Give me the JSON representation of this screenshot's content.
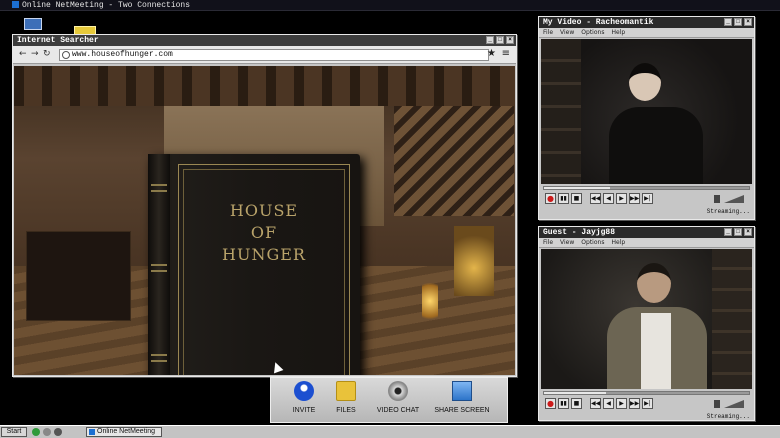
{
  "os": {
    "title": "Online NetMeeting - Two Connections",
    "desktop_icons": [
      "computer-icon",
      "mail-icon"
    ]
  },
  "browser": {
    "title": "Internet Searcher",
    "url": "www.houseofhunger.com",
    "nav": {
      "back": "←",
      "forward": "→",
      "reload": "↻",
      "bookmark": "★",
      "menu": "≡"
    },
    "page": {
      "book_title_lines": [
        "HOUSE",
        "OF",
        "HUNGER"
      ]
    }
  },
  "my_video": {
    "title": "My Video - Racheomantik",
    "menu": [
      "File",
      "View",
      "Options",
      "Help"
    ],
    "progress": 0.32,
    "status": "Streaming..."
  },
  "guest_video": {
    "title": "Guest - Jayjg88",
    "menu": [
      "File",
      "View",
      "Options",
      "Help"
    ],
    "progress": 0.3,
    "status": "Streaming..."
  },
  "player_controls": [
    "●",
    "▮▮",
    "■",
    "◀◀",
    "◀",
    "▶",
    "▶▶",
    "▶|"
  ],
  "dock": {
    "items": [
      {
        "label": "INVITE",
        "icon": "invite-icon"
      },
      {
        "label": "FILES",
        "icon": "folder-icon"
      },
      {
        "label": "VIDEO CHAT",
        "icon": "webcam-icon"
      },
      {
        "label": "SHARE SCREEN",
        "icon": "monitor-icon"
      }
    ]
  },
  "taskbar": {
    "start_label": "Start",
    "task_label": "Online NetMeeting"
  },
  "colors": {
    "accent": "#1c6fd1",
    "window_chrome": "#c6c6c6",
    "title_bar": "#3c3c3c",
    "book_gold": "#b9a36a",
    "record_red": "#cc1a1a"
  }
}
